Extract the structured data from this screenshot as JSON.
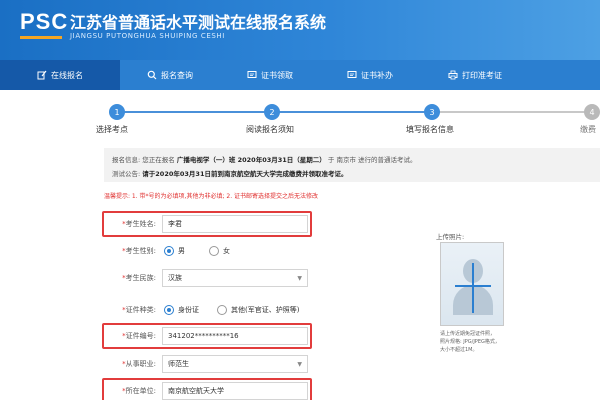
{
  "header": {
    "logo": "PSC",
    "title": "江苏省普通话水平测试在线报名系统",
    "subtitle": "JIANGSU PUTONGHUA SHUIPING CESHI"
  },
  "nav": {
    "items": [
      {
        "label": "在线报名",
        "icon": "edit-icon",
        "active": true
      },
      {
        "label": "报名查询",
        "icon": "search-icon",
        "active": false
      },
      {
        "label": "证书领取",
        "icon": "certificate-icon",
        "active": false
      },
      {
        "label": "证书补办",
        "icon": "certificate-icon",
        "active": false
      },
      {
        "label": "打印准考证",
        "icon": "printer-icon",
        "active": false
      }
    ]
  },
  "steps": [
    {
      "number": "1",
      "label": "选择考点",
      "done": true
    },
    {
      "number": "2",
      "label": "阅读报名须知",
      "done": true
    },
    {
      "number": "3",
      "label": "填写报名信息",
      "done": true
    },
    {
      "number": "4",
      "label": "缴费",
      "done": false
    }
  ],
  "info": {
    "line1_prefix": "报名信息: 您正在报名",
    "line1_bold": "广播电视学（一）班 2020年03月31日（星期二）",
    "line1_suffix": "于 南京市 进行的普通话考试。",
    "line2_prefix": "测试公告:",
    "line2_bold": "请于2020年03月31日前到南京航空航天大学完成缴费并领取准考证。"
  },
  "warning": "温馨提示: 1. 带*号的为必填项,其他为非必填; 2. 证书邮寄选择提交之后无法修改",
  "form": {
    "name_label": "考生姓名:",
    "name_value": "李君",
    "gender_label": "考生性别:",
    "gender_options": [
      "男",
      "女"
    ],
    "gender_selected": "男",
    "ethnicity_label": "考生民族:",
    "ethnicity_value": "汉族",
    "idtype_label": "证件种类:",
    "idtype_options": [
      "身份证",
      "其他(军官证、护照等)"
    ],
    "idtype_selected": "身份证",
    "idnum_label": "证件编号:",
    "idnum_value": "341202**********16",
    "occupation_label": "从事职业:",
    "occupation_value": "师范生",
    "unit_label": "所在单位:",
    "unit_value": "南京航空航天大学"
  },
  "photo": {
    "label": "上传照片:",
    "note1": "请上传近期免冠证件照，",
    "note2": "照片规格: JPG/JPEG格式，",
    "note3": "大小不超过1M。"
  },
  "colors": {
    "header": "#1a6fc4",
    "nav": "#2b7fd0",
    "nav_active": "#1559a8",
    "highlight": "#e23c3c",
    "warning": "#e0302f"
  }
}
